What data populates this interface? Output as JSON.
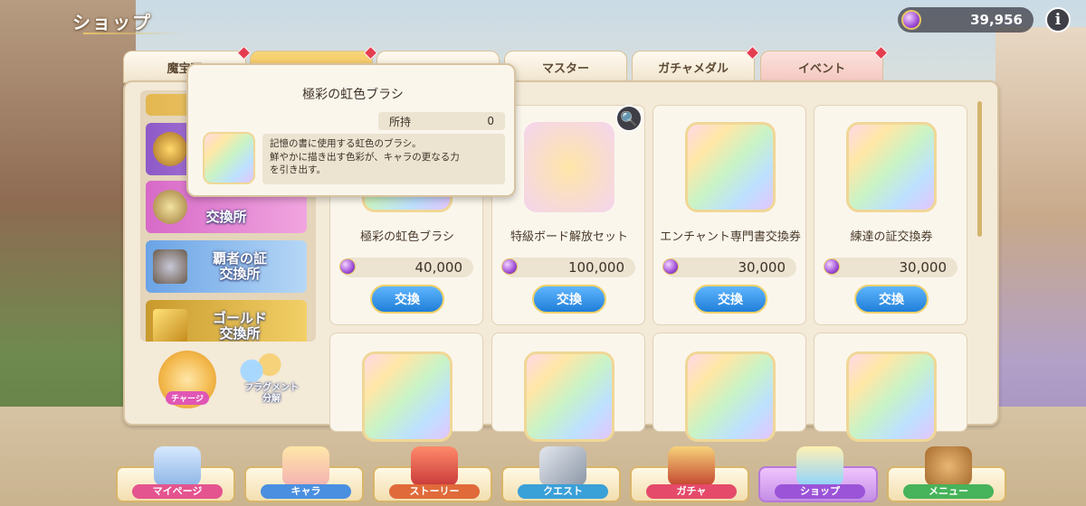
{
  "header": {
    "title": "ショップ",
    "currency_value": "39,956",
    "info_label": "i"
  },
  "tabs": [
    {
      "label": "魔宝石"
    },
    {
      "label": ""
    },
    {
      "label": ""
    },
    {
      "label": "マスター"
    },
    {
      "label": "ガチャメダル"
    },
    {
      "label": "イベント"
    }
  ],
  "sidebar": {
    "banners": [
      {
        "label": ""
      },
      {
        "label": ""
      },
      {
        "label": "交換所"
      },
      {
        "label": "覇者の証\n交換所"
      },
      {
        "label": "ゴールド\n交換所"
      }
    ],
    "charge_label": "チャージ",
    "fragment_label": "フラグメント\n分解"
  },
  "tooltip": {
    "title": "極彩の虹色ブラシ",
    "owned_label": "所持",
    "owned_value": "0",
    "description": "記憶の書に使用する虹色のブラシ。\n鮮やかに描き出す色彩が、キャラの更なる力\nを引き出す。"
  },
  "products": [
    {
      "name": "極彩の虹色ブラシ",
      "price": "40,000",
      "button": "交換"
    },
    {
      "name": "特級ボード解放セット",
      "price": "100,000",
      "button": "交換"
    },
    {
      "name": "エンチャント専門書交換券",
      "price": "30,000",
      "button": "交換"
    },
    {
      "name": "練達の証交換券",
      "price": "30,000",
      "button": "交換"
    }
  ],
  "bottom_nav": [
    {
      "label": "マイページ",
      "color": "#e4548e"
    },
    {
      "label": "キャラ",
      "color": "#4a8fe0"
    },
    {
      "label": "ストーリー",
      "color": "#e06a3a"
    },
    {
      "label": "クエスト",
      "color": "#3aa0d8"
    },
    {
      "label": "ガチャ",
      "color": "#e54a6a"
    },
    {
      "label": "ショップ",
      "color": "#9b54d8"
    },
    {
      "label": "メニュー",
      "color": "#47b35a"
    }
  ]
}
